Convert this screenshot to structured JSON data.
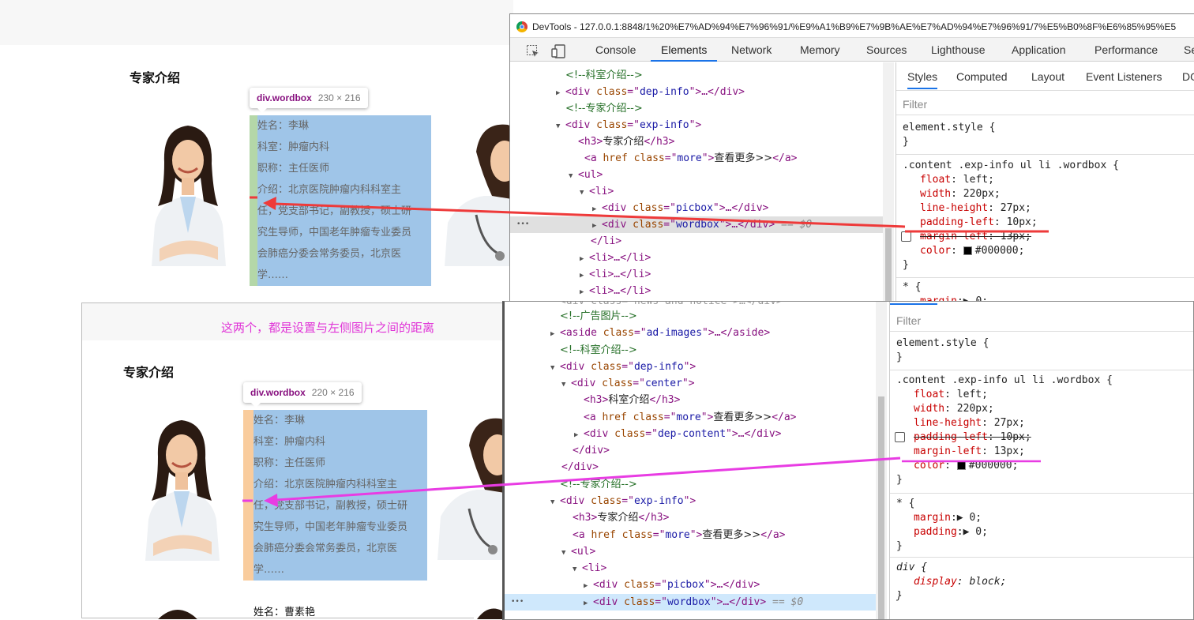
{
  "page_top": {
    "heading": "专家介绍",
    "tooltip": {
      "selector": "div.wordbox",
      "size": "230 × 216"
    },
    "lines": [
      "姓名：李琳",
      "科室：肿瘤内科",
      "职称：主任医师",
      "介绍：北京医院肿瘤内科科室主",
      "任，党支部书记，副教授，硕士研",
      "究生导师，中国老年肿瘤专业委员",
      "会肺癌分委会常务委员，北京医",
      "学……"
    ]
  },
  "page_bottom": {
    "annotation": "这两个，都是设置与左侧图片之间的距离",
    "heading": "专家介绍",
    "tooltip": {
      "selector": "div.wordbox",
      "size": "220 × 216"
    },
    "lines": [
      "姓名：李琳",
      "科室：肿瘤内科",
      "职称：主任医师",
      "介绍：北京医院肿瘤内科科室主",
      "任，党支部书记，副教授，硕士研",
      "究生导师，中国老年肿瘤专业委员",
      "会肺癌分委会常务委员，北京医",
      "学……"
    ],
    "next_name": "姓名：曹素艳"
  },
  "devtools_top": {
    "title": "DevTools - 127.0.0.1:8848/1%20%E7%AD%94%E7%96%91/%E9%A1%B9%E7%9B%AE%E7%AD%94%E7%96%91/7%E5%B0%8F%E6%85%95%E5",
    "tabs": [
      "Console",
      "Elements",
      "Network",
      "Memory",
      "Sources",
      "Lighthouse",
      "Application",
      "Performance",
      "Se"
    ],
    "active_tab": "Elements",
    "style_tabs": [
      "Styles",
      "Computed",
      "Layout",
      "Event Listeners",
      "DO"
    ],
    "filter_placeholder": "Filter",
    "ellipsis": "•••",
    "elements": {
      "r1": "<!--科室介绍-->",
      "r2a": "<div ",
      "r2b": "class",
      "r2c": "=\"",
      "r2d": "dep-info",
      "r2e": "\">…</div>",
      "r3": "<!--专家介绍-->",
      "r4a": "<div ",
      "r4b": "class",
      "r4c": "=\"",
      "r4d": "exp-info",
      "r4e": "\">",
      "r5a": "<h3>",
      "r5b": "专家介绍",
      "r5c": "</h3>",
      "r6a": "<a ",
      "r6b": "href",
      "r6c": " class",
      "r6d": "=\"",
      "r6e": "more",
      "r6f": "\">",
      "r6g": "查看更多>>",
      "r6h": "</a>",
      "r7": "<ul>",
      "r8": "<li>",
      "r9a": "<div ",
      "r9b": "class",
      "r9c": "=\"",
      "r9d": "picbox",
      "r9e": "\">…</div>",
      "r10a": "<div ",
      "r10b": "class",
      "r10c": "=\"",
      "r10d": "wordbox",
      "r10e": "\">…</div>",
      "r10f": " == $0",
      "r11": "</li>",
      "r12": "<li>…</li>",
      "r13": "<li>…</li>",
      "r14": "<li>…</li>"
    },
    "styles": {
      "element_style": "element.style {",
      "close": "}",
      "selector": ".content .exp-info ul li .wordbox {",
      "p1": "float",
      "v1": "left;",
      "p2": "width",
      "v2": "220px;",
      "p3": "line-height",
      "v3": "27px;",
      "p4": "padding-left",
      "v4": "10px;",
      "p5": "margin-left",
      "v5": "13px;",
      "p6": "color",
      "v6": "#000000;",
      "star": "* {",
      "p7": "margin",
      "v7": "0;"
    }
  },
  "devtools_bottom": {
    "filter_placeholder": "Filter",
    "ellipsis": "•••",
    "elements": {
      "r0": "<div class=\"news-and-notice\">…</div>",
      "r1": "<!--广告图片-->",
      "r2a": "<aside ",
      "r2b": "class",
      "r2c": "=\"",
      "r2d": "ad-images",
      "r2e": "\">…</aside>",
      "r3": "<!--科室介绍-->",
      "r4a": "<div ",
      "r4b": "class",
      "r4c": "=\"",
      "r4d": "dep-info",
      "r4e": "\">",
      "r5a": "<div ",
      "r5b": "class",
      "r5c": "=\"",
      "r5d": "center",
      "r5e": "\">",
      "r6a": "<h3>",
      "r6b": "科室介绍",
      "r6c": "</h3>",
      "r7a": "<a ",
      "r7b": "href",
      "r7c": " class",
      "r7d": "=\"",
      "r7e": "more",
      "r7f": "\">",
      "r7g": "查看更多>>",
      "r7h": "</a>",
      "r8a": "<div ",
      "r8b": "class",
      "r8c": "=\"",
      "r8d": "dep-content",
      "r8e": "\">…</div>",
      "r9": "</div>",
      "r10": "</div>",
      "r11": "<!--专家介绍-->",
      "r12a": "<div ",
      "r12b": "class",
      "r12c": "=\"",
      "r12d": "exp-info",
      "r12e": "\">",
      "r13a": "<h3>",
      "r13b": "专家介绍",
      "r13c": "</h3>",
      "r14a": "<a ",
      "r14b": "href",
      "r14c": " class",
      "r14d": "=\"",
      "r14e": "more",
      "r14f": "\">",
      "r14g": "查看更多>>",
      "r14h": "</a>",
      "r15": "<ul>",
      "r16": "<li>",
      "r17a": "<div ",
      "r17b": "class",
      "r17c": "=\"",
      "r17d": "picbox",
      "r17e": "\">…</div>",
      "r18a": "<div ",
      "r18b": "class",
      "r18c": "=\"",
      "r18d": "wordbox",
      "r18e": "\">…</div>",
      "r18f": " == $0"
    },
    "styles": {
      "element_style": "element.style {",
      "close": "}",
      "selector": ".content .exp-info ul li .wordbox {",
      "p1": "float",
      "v1": "left;",
      "p2": "width",
      "v2": "220px;",
      "p3": "line-height",
      "v3": "27px;",
      "p4": "padding-left",
      "v4": "10px;",
      "p5": "margin-left",
      "v5": "13px;",
      "p6": "color",
      "v6": "#000000;",
      "star": "* {",
      "p7": "margin",
      "v7": "0;",
      "p8": "padding",
      "v8": "0;",
      "div_sel": "div {",
      "p9": "display",
      "v9": "block;"
    }
  },
  "colors": {
    "red_arrow": "#ee3a3a",
    "magenta_arrow": "#e83ce3",
    "wordbox_blue": "#9fc5e8",
    "padding_green": "#b4d7a8",
    "margin_orange": "#f9cc9d"
  }
}
